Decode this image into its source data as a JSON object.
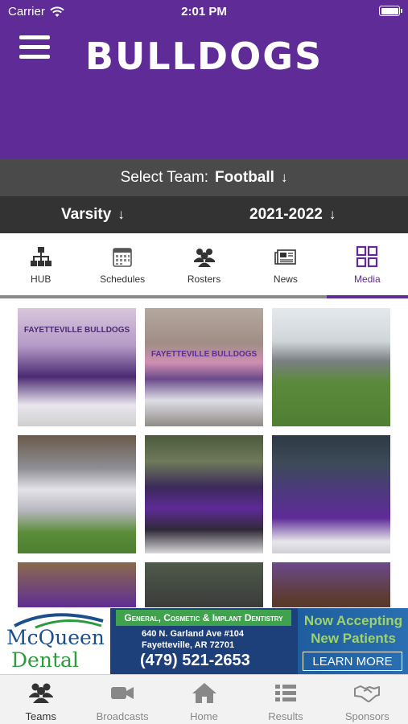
{
  "status_bar": {
    "carrier": "Carrier",
    "time": "2:01 PM"
  },
  "header": {
    "brand": "BULLDOGS",
    "background": "#5e2b97"
  },
  "team_selector": {
    "prefix": "Select Team:",
    "value": "Football"
  },
  "filters": {
    "level": "Varsity",
    "season": "2021-2022"
  },
  "section_tabs": [
    {
      "label": "HUB",
      "icon": "org-chart-icon"
    },
    {
      "label": "Schedules",
      "icon": "calendar-icon"
    },
    {
      "label": "Rosters",
      "icon": "people-icon"
    },
    {
      "label": "News",
      "icon": "newspaper-icon"
    },
    {
      "label": "Media",
      "icon": "grid-icon",
      "active": true
    }
  ],
  "media_grid": [
    {
      "tag": "FAYETTEVILLE BULLDOGS"
    },
    {
      "tag": "FAYETTEVILLE BULLDOGS"
    },
    {
      "tag": ""
    },
    {
      "tag": ""
    },
    {
      "tag": ""
    },
    {
      "tag": ""
    },
    {
      "tag": ""
    },
    {
      "tag": ""
    },
    {
      "tag": ""
    }
  ],
  "ad": {
    "logo_line1": "McQueen",
    "logo_line2": "Dental",
    "banner": "General, Cosmetic & Implant Dentistry",
    "address_line1": "640 N. Garland Ave #104",
    "address_line2": "Fayetteville, AR 72701",
    "phone": "(479) 521-2653",
    "accepting_line1": "Now Accepting",
    "accepting_line2": "New Patients",
    "cta": "LEARN MORE"
  },
  "bottom_nav": [
    {
      "label": "Teams",
      "icon": "teams-icon",
      "active": true
    },
    {
      "label": "Broadcasts",
      "icon": "video-camera-icon"
    },
    {
      "label": "Home",
      "icon": "home-icon"
    },
    {
      "label": "Results",
      "icon": "list-icon"
    },
    {
      "label": "Sponsors",
      "icon": "handshake-icon"
    }
  ]
}
